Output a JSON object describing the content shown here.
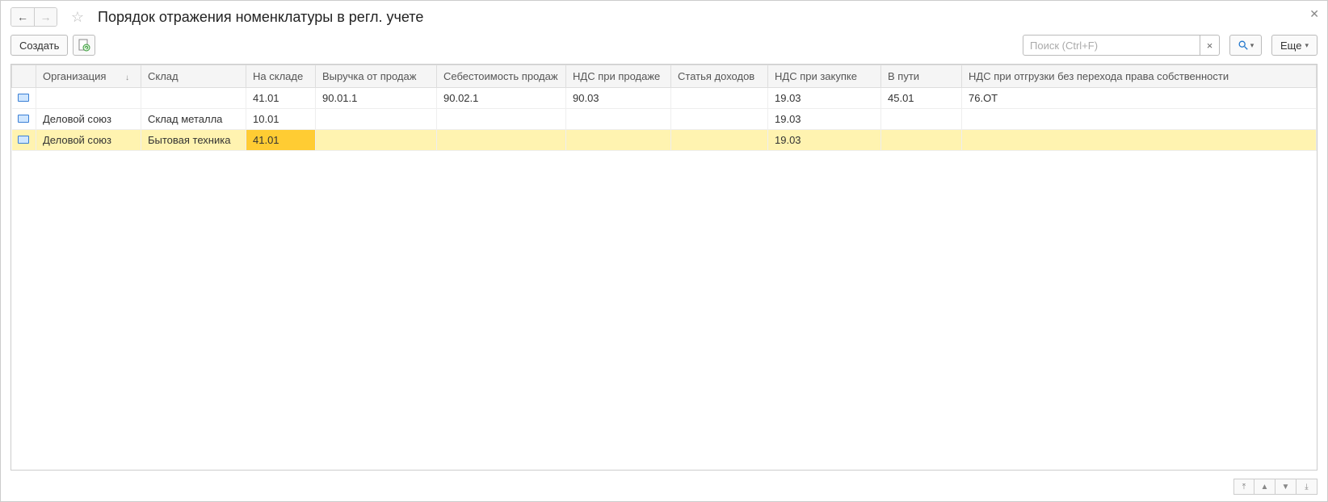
{
  "title": "Порядок отражения номенклатуры в регл. учете",
  "toolbar": {
    "create_label": "Создать",
    "more_label": "Еще"
  },
  "search": {
    "placeholder": "Поиск (Ctrl+F)"
  },
  "table": {
    "columns": [
      "Организация",
      "Склад",
      "На складе",
      "Выручка от продаж",
      "Себестоимость продаж",
      "НДС при продаже",
      "Статья доходов",
      "НДС при закупке",
      "В пути",
      "НДС при отгрузки без перехода права собственности"
    ],
    "rows": [
      {
        "org": "",
        "sklad": "",
        "na_sklade": "41.01",
        "vyr": "90.01.1",
        "seb": "90.02.1",
        "nds_prod": "90.03",
        "statya": "",
        "nds_zak": "19.03",
        "v_puti": "45.01",
        "nds_otgr": "76.ОТ",
        "selected": false,
        "highlight": false
      },
      {
        "org": "Деловой союз",
        "sklad": "Склад металла",
        "na_sklade": "10.01",
        "vyr": "",
        "seb": "",
        "nds_prod": "",
        "statya": "",
        "nds_zak": "19.03",
        "v_puti": "",
        "nds_otgr": "",
        "selected": false,
        "highlight": false
      },
      {
        "org": "Деловой союз",
        "sklad": "Бытовая техника",
        "na_sklade": "41.01",
        "vyr": "",
        "seb": "",
        "nds_prod": "",
        "statya": "",
        "nds_zak": "19.03",
        "v_puti": "",
        "nds_otgr": "",
        "selected": true,
        "highlight": true
      }
    ]
  }
}
